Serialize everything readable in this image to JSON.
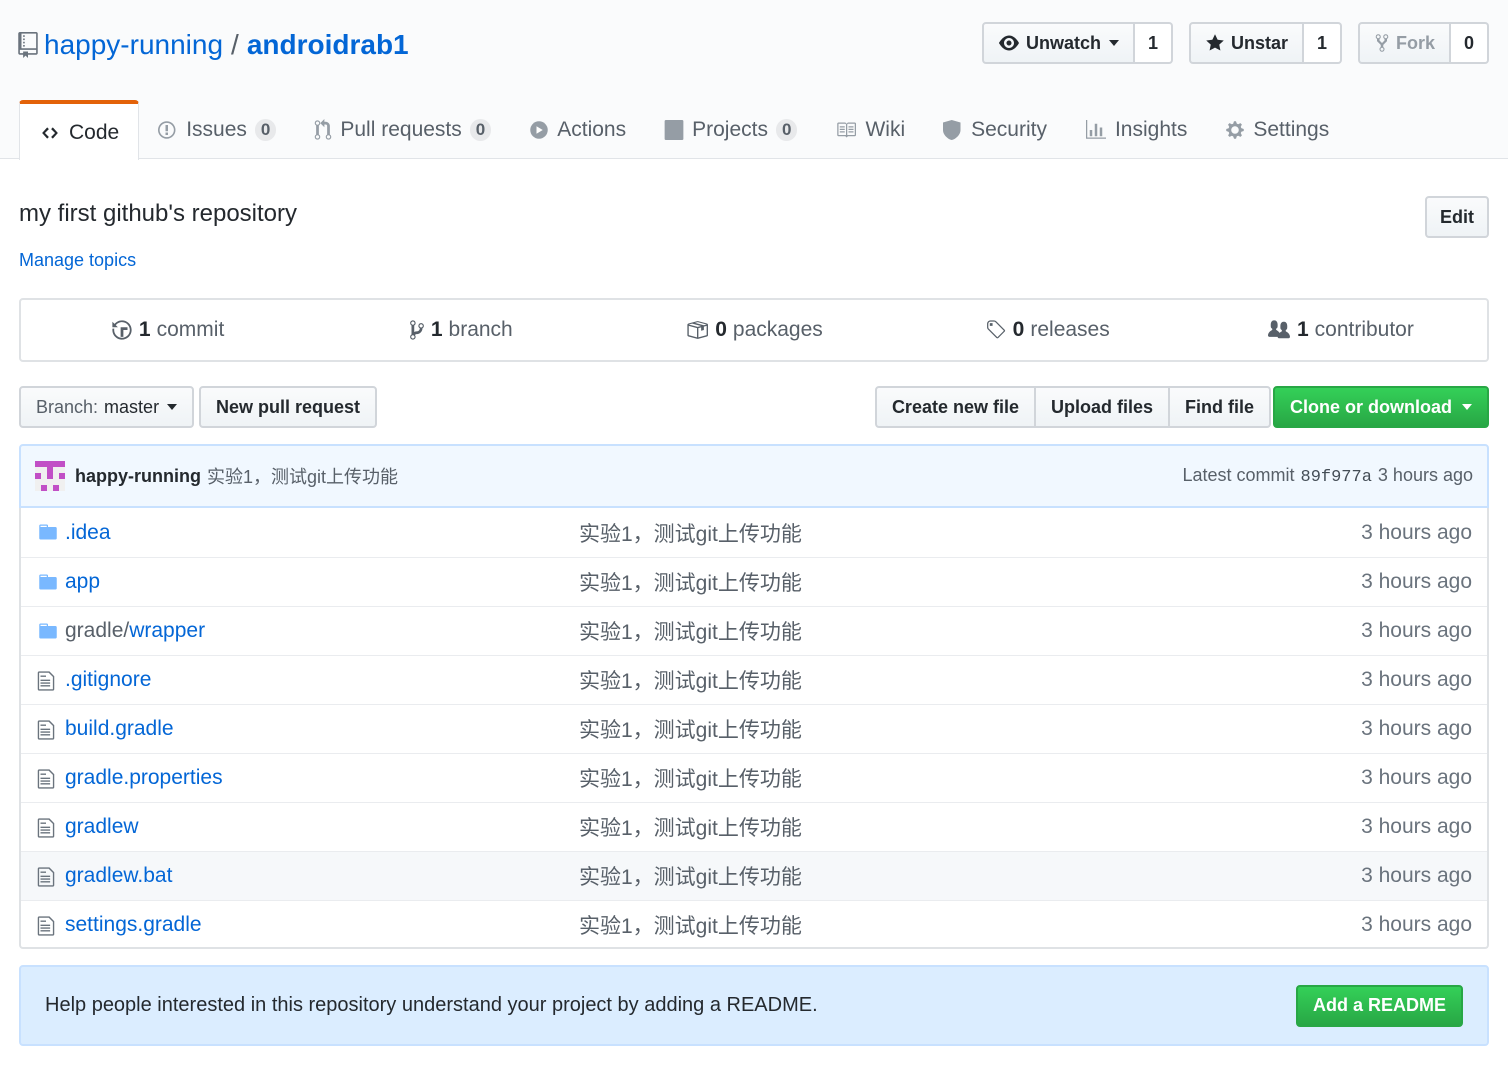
{
  "repo": {
    "owner": "happy-running",
    "separator": "/",
    "name": "androidrab1",
    "description": "my first github's repository",
    "manage_topics": "Manage topics",
    "edit_label": "Edit"
  },
  "actions": {
    "watch": {
      "label": "Unwatch",
      "count": "1"
    },
    "star": {
      "label": "Unstar",
      "count": "1"
    },
    "fork": {
      "label": "Fork",
      "count": "0"
    }
  },
  "tabs": [
    {
      "label": "Code",
      "icon": "code-icon",
      "selected": true
    },
    {
      "label": "Issues",
      "count": "0",
      "icon": "issue-icon"
    },
    {
      "label": "Pull requests",
      "count": "0",
      "icon": "pull-request-icon"
    },
    {
      "label": "Actions",
      "icon": "play-icon"
    },
    {
      "label": "Projects",
      "count": "0",
      "icon": "project-icon"
    },
    {
      "label": "Wiki",
      "icon": "book-icon"
    },
    {
      "label": "Security",
      "icon": "shield-icon"
    },
    {
      "label": "Insights",
      "icon": "graph-icon"
    },
    {
      "label": "Settings",
      "icon": "gear-icon"
    }
  ],
  "summary": [
    {
      "num": "1",
      "label": "commit",
      "icon": "history-icon"
    },
    {
      "num": "1",
      "label": "branch",
      "icon": "branch-icon"
    },
    {
      "num": "0",
      "label": "packages",
      "icon": "package-icon"
    },
    {
      "num": "0",
      "label": "releases",
      "icon": "tag-icon"
    },
    {
      "num": "1",
      "label": "contributor",
      "icon": "people-icon"
    }
  ],
  "filenav": {
    "branch_label": "Branch:",
    "branch_value": "master",
    "new_pr": "New pull request",
    "create_file": "Create new file",
    "upload_files": "Upload files",
    "find_file": "Find file",
    "clone": "Clone or download"
  },
  "commit": {
    "author": "happy-running",
    "message": "实验1，测试git上传功能",
    "latest_label": "Latest commit",
    "sha": "89f977a",
    "age": "3 hours ago"
  },
  "files": [
    {
      "type": "dir",
      "name": ".idea",
      "message": "实验1，测试git上传功能",
      "age": "3 hours ago"
    },
    {
      "type": "dir",
      "name": "app",
      "message": "实验1，测试git上传功能",
      "age": "3 hours ago"
    },
    {
      "type": "dir",
      "prefix": "gradle/",
      "name": "wrapper",
      "message": "实验1，测试git上传功能",
      "age": "3 hours ago"
    },
    {
      "type": "file",
      "name": ".gitignore",
      "message": "实验1，测试git上传功能",
      "age": "3 hours ago"
    },
    {
      "type": "file",
      "name": "build.gradle",
      "message": "实验1，测试git上传功能",
      "age": "3 hours ago"
    },
    {
      "type": "file",
      "name": "gradle.properties",
      "message": "实验1，测试git上传功能",
      "age": "3 hours ago"
    },
    {
      "type": "file",
      "name": "gradlew",
      "message": "实验1，测试git上传功能",
      "age": "3 hours ago"
    },
    {
      "type": "file",
      "name": "gradlew.bat",
      "message": "实验1，测试git上传功能",
      "age": "3 hours ago"
    },
    {
      "type": "file",
      "name": "settings.gradle",
      "message": "实验1，测试git上传功能",
      "age": "3 hours ago"
    }
  ],
  "readme_prompt": {
    "text": "Help people interested in this repository understand your project by adding a README.",
    "button": "Add a README"
  },
  "colors": {
    "link": "#0366d6",
    "tab_accent": "#e36209",
    "green": "#28a745",
    "commit_bg": "#f1f8ff",
    "readme_bg": "#dbedff"
  }
}
